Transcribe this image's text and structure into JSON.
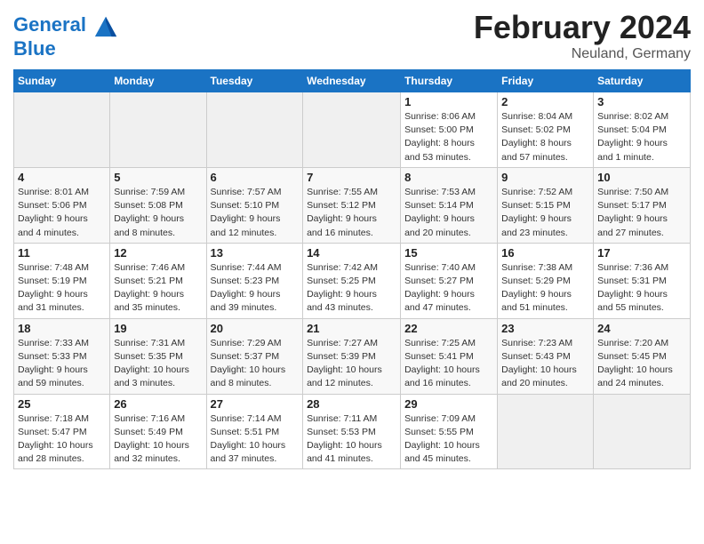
{
  "header": {
    "logo_line1": "General",
    "logo_line2": "Blue",
    "month_title": "February 2024",
    "subtitle": "Neuland, Germany"
  },
  "weekdays": [
    "Sunday",
    "Monday",
    "Tuesday",
    "Wednesday",
    "Thursday",
    "Friday",
    "Saturday"
  ],
  "weeks": [
    [
      {
        "day": "",
        "empty": true
      },
      {
        "day": "",
        "empty": true
      },
      {
        "day": "",
        "empty": true
      },
      {
        "day": "",
        "empty": true
      },
      {
        "day": "1",
        "info": "Sunrise: 8:06 AM\nSunset: 5:00 PM\nDaylight: 8 hours\nand 53 minutes."
      },
      {
        "day": "2",
        "info": "Sunrise: 8:04 AM\nSunset: 5:02 PM\nDaylight: 8 hours\nand 57 minutes."
      },
      {
        "day": "3",
        "info": "Sunrise: 8:02 AM\nSunset: 5:04 PM\nDaylight: 9 hours\nand 1 minute."
      }
    ],
    [
      {
        "day": "4",
        "info": "Sunrise: 8:01 AM\nSunset: 5:06 PM\nDaylight: 9 hours\nand 4 minutes."
      },
      {
        "day": "5",
        "info": "Sunrise: 7:59 AM\nSunset: 5:08 PM\nDaylight: 9 hours\nand 8 minutes."
      },
      {
        "day": "6",
        "info": "Sunrise: 7:57 AM\nSunset: 5:10 PM\nDaylight: 9 hours\nand 12 minutes."
      },
      {
        "day": "7",
        "info": "Sunrise: 7:55 AM\nSunset: 5:12 PM\nDaylight: 9 hours\nand 16 minutes."
      },
      {
        "day": "8",
        "info": "Sunrise: 7:53 AM\nSunset: 5:14 PM\nDaylight: 9 hours\nand 20 minutes."
      },
      {
        "day": "9",
        "info": "Sunrise: 7:52 AM\nSunset: 5:15 PM\nDaylight: 9 hours\nand 23 minutes."
      },
      {
        "day": "10",
        "info": "Sunrise: 7:50 AM\nSunset: 5:17 PM\nDaylight: 9 hours\nand 27 minutes."
      }
    ],
    [
      {
        "day": "11",
        "info": "Sunrise: 7:48 AM\nSunset: 5:19 PM\nDaylight: 9 hours\nand 31 minutes."
      },
      {
        "day": "12",
        "info": "Sunrise: 7:46 AM\nSunset: 5:21 PM\nDaylight: 9 hours\nand 35 minutes."
      },
      {
        "day": "13",
        "info": "Sunrise: 7:44 AM\nSunset: 5:23 PM\nDaylight: 9 hours\nand 39 minutes."
      },
      {
        "day": "14",
        "info": "Sunrise: 7:42 AM\nSunset: 5:25 PM\nDaylight: 9 hours\nand 43 minutes."
      },
      {
        "day": "15",
        "info": "Sunrise: 7:40 AM\nSunset: 5:27 PM\nDaylight: 9 hours\nand 47 minutes."
      },
      {
        "day": "16",
        "info": "Sunrise: 7:38 AM\nSunset: 5:29 PM\nDaylight: 9 hours\nand 51 minutes."
      },
      {
        "day": "17",
        "info": "Sunrise: 7:36 AM\nSunset: 5:31 PM\nDaylight: 9 hours\nand 55 minutes."
      }
    ],
    [
      {
        "day": "18",
        "info": "Sunrise: 7:33 AM\nSunset: 5:33 PM\nDaylight: 9 hours\nand 59 minutes."
      },
      {
        "day": "19",
        "info": "Sunrise: 7:31 AM\nSunset: 5:35 PM\nDaylight: 10 hours\nand 3 minutes."
      },
      {
        "day": "20",
        "info": "Sunrise: 7:29 AM\nSunset: 5:37 PM\nDaylight: 10 hours\nand 8 minutes."
      },
      {
        "day": "21",
        "info": "Sunrise: 7:27 AM\nSunset: 5:39 PM\nDaylight: 10 hours\nand 12 minutes."
      },
      {
        "day": "22",
        "info": "Sunrise: 7:25 AM\nSunset: 5:41 PM\nDaylight: 10 hours\nand 16 minutes."
      },
      {
        "day": "23",
        "info": "Sunrise: 7:23 AM\nSunset: 5:43 PM\nDaylight: 10 hours\nand 20 minutes."
      },
      {
        "day": "24",
        "info": "Sunrise: 7:20 AM\nSunset: 5:45 PM\nDaylight: 10 hours\nand 24 minutes."
      }
    ],
    [
      {
        "day": "25",
        "info": "Sunrise: 7:18 AM\nSunset: 5:47 PM\nDaylight: 10 hours\nand 28 minutes."
      },
      {
        "day": "26",
        "info": "Sunrise: 7:16 AM\nSunset: 5:49 PM\nDaylight: 10 hours\nand 32 minutes."
      },
      {
        "day": "27",
        "info": "Sunrise: 7:14 AM\nSunset: 5:51 PM\nDaylight: 10 hours\nand 37 minutes."
      },
      {
        "day": "28",
        "info": "Sunrise: 7:11 AM\nSunset: 5:53 PM\nDaylight: 10 hours\nand 41 minutes."
      },
      {
        "day": "29",
        "info": "Sunrise: 7:09 AM\nSunset: 5:55 PM\nDaylight: 10 hours\nand 45 minutes."
      },
      {
        "day": "",
        "empty": true
      },
      {
        "day": "",
        "empty": true
      }
    ]
  ]
}
